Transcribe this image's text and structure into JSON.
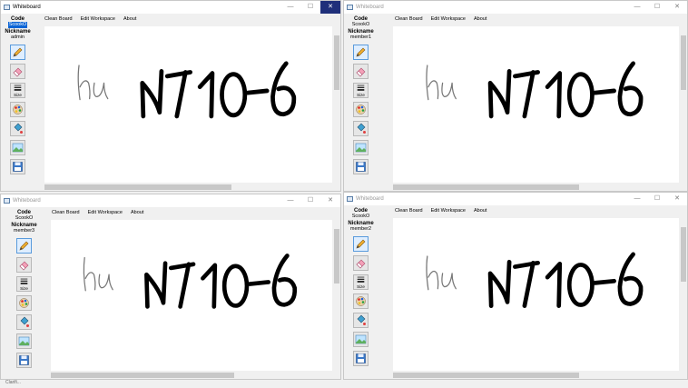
{
  "app_title": "Whiteboard",
  "menu": [
    "Clean Board",
    "Edit Workspace",
    "About"
  ],
  "labels": {
    "code": "Code",
    "nickname": "Nickname"
  },
  "windows": [
    {
      "id": "admin",
      "code_value": "ScookO",
      "code_selected": true,
      "nickname": "admin",
      "active": true
    },
    {
      "id": "member1",
      "code_value": "ScookO",
      "code_selected": false,
      "nickname": "member1",
      "active": false
    },
    {
      "id": "member3",
      "code_value": "ScookO",
      "code_selected": false,
      "nickname": "member3",
      "active": false
    },
    {
      "id": "member2",
      "code_value": "ScookO",
      "code_selected": false,
      "nickname": "member2",
      "active": false
    }
  ],
  "tools": [
    {
      "name": "pencil-tool",
      "icon": "pencil-icon",
      "active": true
    },
    {
      "name": "eraser-tool",
      "icon": "eraser-icon",
      "active": false
    },
    {
      "name": "size-tool",
      "icon": "line-size-icon",
      "label": "Size",
      "active": false
    },
    {
      "name": "color-tool",
      "icon": "palette-icon",
      "active": false
    },
    {
      "name": "fill-tool",
      "icon": "paint-bucket-icon",
      "active": false
    },
    {
      "name": "background-tool",
      "icon": "image-icon",
      "active": false
    },
    {
      "name": "save-tool",
      "icon": "floppy-disk-icon",
      "active": false
    }
  ],
  "window_controls": [
    "minimize",
    "maximize",
    "close"
  ],
  "canvas_text": "NT10-6",
  "taskbar_fragment": "Clarifi..."
}
